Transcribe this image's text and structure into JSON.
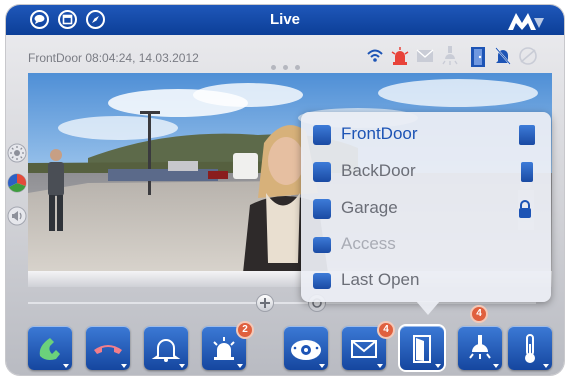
{
  "topbar": {
    "title": "Live",
    "left_icons": [
      "speech-bubble-icon",
      "window-icon",
      "compass-icon"
    ],
    "logo": "mobotix-logo"
  },
  "status": {
    "camera_info": "FrontDoor 08:04:24, 14.03.2012",
    "icons": [
      "wifi-icon",
      "alarm-icon",
      "mail-icon",
      "light-icon",
      "door-icon",
      "bell-muted-icon",
      "globe-icon"
    ],
    "alarm_color": "#e8433a",
    "accent": "#1d54b5"
  },
  "left_controls": [
    "brightness-icon",
    "color-icon",
    "volume-icon"
  ],
  "door_menu": {
    "items": [
      {
        "label": "FrontDoor",
        "selected": true,
        "status_icon": "door-open-icon"
      },
      {
        "label": "BackDoor",
        "selected": false,
        "status_icon": "door-closed-icon"
      },
      {
        "label": "Garage",
        "selected": false,
        "status_icon": "lock-icon"
      },
      {
        "label": "Access",
        "selected": false,
        "status_icon": ""
      },
      {
        "label": "Last Open",
        "selected": false,
        "status_icon": ""
      }
    ]
  },
  "toolbar": {
    "buttons": [
      {
        "name": "accept-call-icon",
        "badge": ""
      },
      {
        "name": "hang-up-icon",
        "badge": ""
      },
      {
        "name": "bell-icon",
        "badge": ""
      },
      {
        "name": "alarm-light-icon",
        "badge": "2"
      },
      {
        "name": "fisheye-camera-icon",
        "badge": ""
      },
      {
        "name": "mail-icon",
        "badge": "4"
      },
      {
        "name": "door-icon",
        "badge": ""
      },
      {
        "name": "light-icon",
        "badge": "4"
      },
      {
        "name": "thermometer-icon",
        "badge": ""
      }
    ]
  }
}
